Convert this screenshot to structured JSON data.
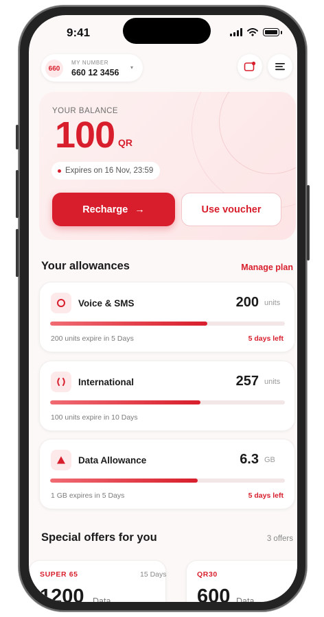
{
  "status_bar": {
    "time": "9:41"
  },
  "header": {
    "number_badge": "660",
    "number_label": "MY NUMBER",
    "number_value": "660 12 3456",
    "caret": "▾"
  },
  "balance": {
    "label": "YOUR BALANCE",
    "amount": "100",
    "currency": "QR",
    "expiry": "Expires on 16 Nov, 23:59",
    "recharge_label": "Recharge",
    "recharge_arrow": "→",
    "voucher_label": "Use voucher"
  },
  "allowances": {
    "title": "Your allowances",
    "manage_label": "Manage plan",
    "items": [
      {
        "name": "Voice & SMS",
        "value": "200",
        "unit": "units",
        "note": "200 units expire in 5 Days",
        "days_left": "5 days left",
        "progress": 0.67,
        "icon": "voice-circle-icon"
      },
      {
        "name": "International",
        "value": "257",
        "unit": "units",
        "note": "100 units expire in 10 Days",
        "days_left": "",
        "progress": 0.64,
        "icon": "international-brackets-icon"
      },
      {
        "name": "Data Allowance",
        "value": "6.3",
        "unit": "GB",
        "note": "1 GB expires in 5 Days",
        "days_left": "5 days left",
        "progress": 0.63,
        "icon": "data-triangle-icon"
      }
    ]
  },
  "offers": {
    "title": "Special offers for you",
    "count": "3 offers",
    "items": [
      {
        "name": "SUPER 65",
        "validity": "15 Days",
        "amount": "1200",
        "unit": "Data"
      },
      {
        "name": "QR30",
        "validity": "",
        "amount": "600",
        "unit": "Data"
      }
    ]
  },
  "colors": {
    "accent": "#d81e2c",
    "accent_light": "#fde9ea",
    "background": "#fbf8f7"
  }
}
